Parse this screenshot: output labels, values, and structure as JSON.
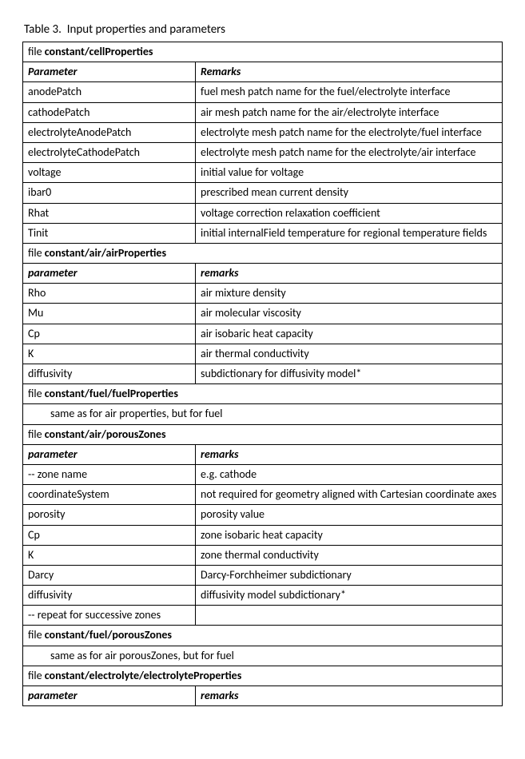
{
  "caption_prefix": "Table 3.",
  "caption_text": "Input properties and parameters",
  "sections": [
    {
      "file_label": "file ",
      "file_path": "constant/cellProperties",
      "header_param": "Parameter",
      "header_remark": "Remarks",
      "rows": [
        {
          "param": "anodePatch",
          "remark": "fuel mesh patch name for the fuel/electrolyte interface"
        },
        {
          "param": "cathodePatch",
          "remark": "air mesh patch name for the air/electrolyte interface"
        },
        {
          "param": "electrolyteAnodePatch",
          "remark": "electrolyte mesh patch name for the electrolyte/fuel interface"
        },
        {
          "param": "electrolyteCathodePatch",
          "remark": "electrolyte mesh patch name for the electrolyte/air interface"
        },
        {
          "param": "voltage",
          "remark": "initial value for voltage"
        },
        {
          "param": "ibar0",
          "remark": "prescribed mean current density"
        },
        {
          "param": "Rhat",
          "remark": "voltage correction relaxation coefficient"
        },
        {
          "param": "Tinit",
          "remark": "initial internalField temperature for regional temperature fields"
        }
      ]
    },
    {
      "file_label": "file ",
      "file_path": "constant/air/airProperties",
      "header_param": "parameter",
      "header_remark": "remarks",
      "rows": [
        {
          "param": "Rho",
          "remark": "air mixture density"
        },
        {
          "param": "Mu",
          "remark": "air molecular viscosity"
        },
        {
          "param": "Cp",
          "remark": "air isobaric heat capacity"
        },
        {
          "param": "K",
          "remark": "air thermal conductivity"
        },
        {
          "param": "diffusivity",
          "remark": "subdictionary for diffusivity model*"
        }
      ]
    },
    {
      "file_label": "file ",
      "file_path": "constant/fuel/fuelProperties",
      "note": "same as for air properties, but for fuel"
    },
    {
      "file_label": "file ",
      "file_path": "constant/air/porousZones",
      "header_param": "parameter",
      "header_remark": "remarks",
      "rows": [
        {
          "param": "-- zone name",
          "remark": "e.g. cathode"
        },
        {
          "param": "coordinateSystem",
          "remark": "not required for geometry aligned with Cartesian coordinate axes"
        },
        {
          "param": "porosity",
          "remark": "porosity value"
        },
        {
          "param": "Cp",
          "remark": "zone isobaric heat capacity"
        },
        {
          "param": "K",
          "remark": "zone thermal conductivity"
        },
        {
          "param": "Darcy",
          "remark": "Darcy-Forchheimer subdictionary"
        },
        {
          "param": "diffusivity",
          "remark": "diffusivity model subdictionary*"
        },
        {
          "param": "-- repeat for successive zones",
          "remark": ""
        }
      ]
    },
    {
      "file_label": "file ",
      "file_path": "constant/fuel/porousZones",
      "note": "same as for air porousZones, but for fuel"
    },
    {
      "file_label": "file ",
      "file_path": "constant/electrolyte/electrolyteProperties",
      "header_param": "parameter",
      "header_remark": "remarks",
      "rows": []
    }
  ]
}
